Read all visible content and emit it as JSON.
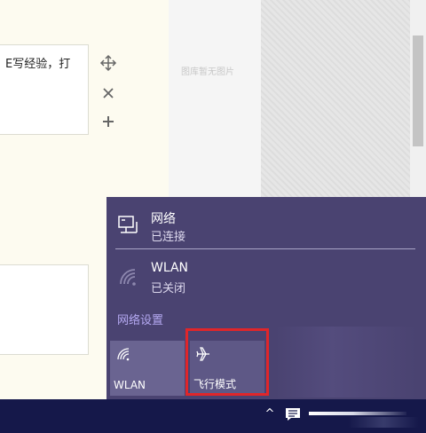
{
  "editor": {
    "text_top": "E写经验，打",
    "tools": {
      "move_icon": "move-icon",
      "close_icon": "close-icon",
      "add_icon": "plus-icon"
    }
  },
  "gallery": {
    "empty_text": "图库暂无图片"
  },
  "network_flyout": {
    "network": {
      "title": "网络",
      "status": "已连接",
      "icon": "wired-network-icon"
    },
    "wlan": {
      "title": "WLAN",
      "status": "已关闭",
      "icon": "wifi-off-icon"
    },
    "settings_link": "网络设置",
    "tiles": [
      {
        "label": "WLAN",
        "icon": "wifi-icon"
      },
      {
        "label": "飞行模式",
        "icon": "airplane-icon"
      }
    ],
    "colors": {
      "background": "#4a4371",
      "link": "#b5a9f2",
      "highlight": "#e0262a"
    }
  },
  "taskbar": {
    "show_hidden_icon": "^",
    "background": "#15184a"
  }
}
